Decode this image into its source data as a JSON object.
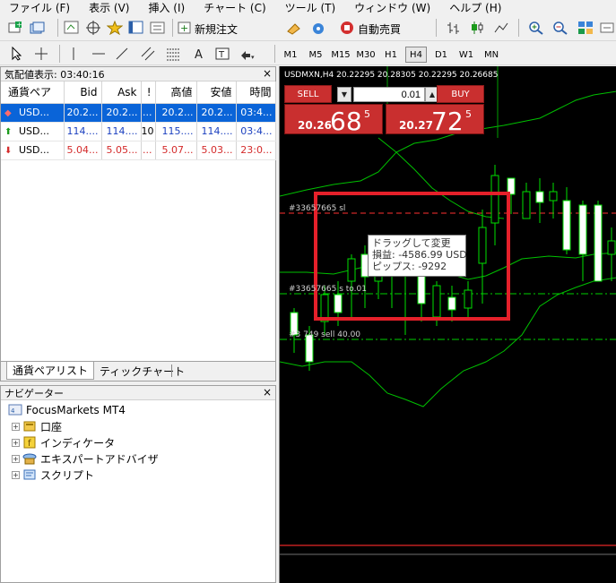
{
  "menu": [
    "ファイル (F)",
    "表示 (V)",
    "挿入 (I)",
    "チャート (C)",
    "ツール (T)",
    "ウィンドウ (W)",
    "ヘルプ (H)"
  ],
  "toolbar": {
    "new_order_label": "新規注文",
    "auto_trade_label": "自動売買"
  },
  "timeframes": [
    {
      "label": "M1",
      "active": false
    },
    {
      "label": "M5",
      "active": false
    },
    {
      "label": "M15",
      "active": false
    },
    {
      "label": "M30",
      "active": false
    },
    {
      "label": "H1",
      "active": false
    },
    {
      "label": "H4",
      "active": true
    },
    {
      "label": "D1",
      "active": false
    },
    {
      "label": "W1",
      "active": false
    },
    {
      "label": "MN",
      "active": false
    }
  ],
  "market_watch": {
    "title": "気配値表示: 03:40:16",
    "columns": [
      "通貨ペア",
      "Bid",
      "Ask",
      "!",
      "高値",
      "安値",
      "時間"
    ],
    "rows": [
      {
        "symbol": "USD...",
        "bid": "20.2...",
        "ask": "20.2...",
        "spread": "...",
        "high": "20.2...",
        "low": "20.2...",
        "time": "03:4..."
      },
      {
        "symbol": "USD...",
        "bid": "114....",
        "ask": "114....",
        "spread": "10",
        "high": "115....",
        "low": "114....",
        "time": "03:4..."
      },
      {
        "symbol": "USD...",
        "bid": "5.04...",
        "ask": "5.05...",
        "spread": "...",
        "high": "5.07...",
        "low": "5.03...",
        "time": "23:0..."
      }
    ],
    "tabs": [
      "通貨ペアリスト",
      "ティックチャート"
    ]
  },
  "navigator": {
    "title": "ナビゲーター",
    "root": "FocusMarkets MT4",
    "items": [
      "口座",
      "インディケータ",
      "エキスパートアドバイザ",
      "スクリプト"
    ]
  },
  "chart": {
    "symbol_line": "USDMXN,H4  20.22295 20.28305 20.22295 20.26685",
    "sell_label": "SELL",
    "buy_label": "BUY",
    "lot": "0.01",
    "sell_small": "20.26",
    "sell_big": "68",
    "sell_sup": "5",
    "buy_small": "20.27",
    "buy_big": "72",
    "buy_sup": "5",
    "line_labels": [
      "#33657665 sl",
      "#33657665 s  to.01",
      "#3  749 sell 40.00"
    ],
    "tooltip": [
      "ドラッグして変更",
      "損益: -4586.99 USD",
      "ピップス: -9292"
    ],
    "colors": {
      "background": "#000000",
      "candle": "#00ff00",
      "bear_body": "#ffffff",
      "bands": "#00c000",
      "sl_line": "#ff3030",
      "order_line": "#00d000",
      "highlight": "#e5202a"
    }
  }
}
